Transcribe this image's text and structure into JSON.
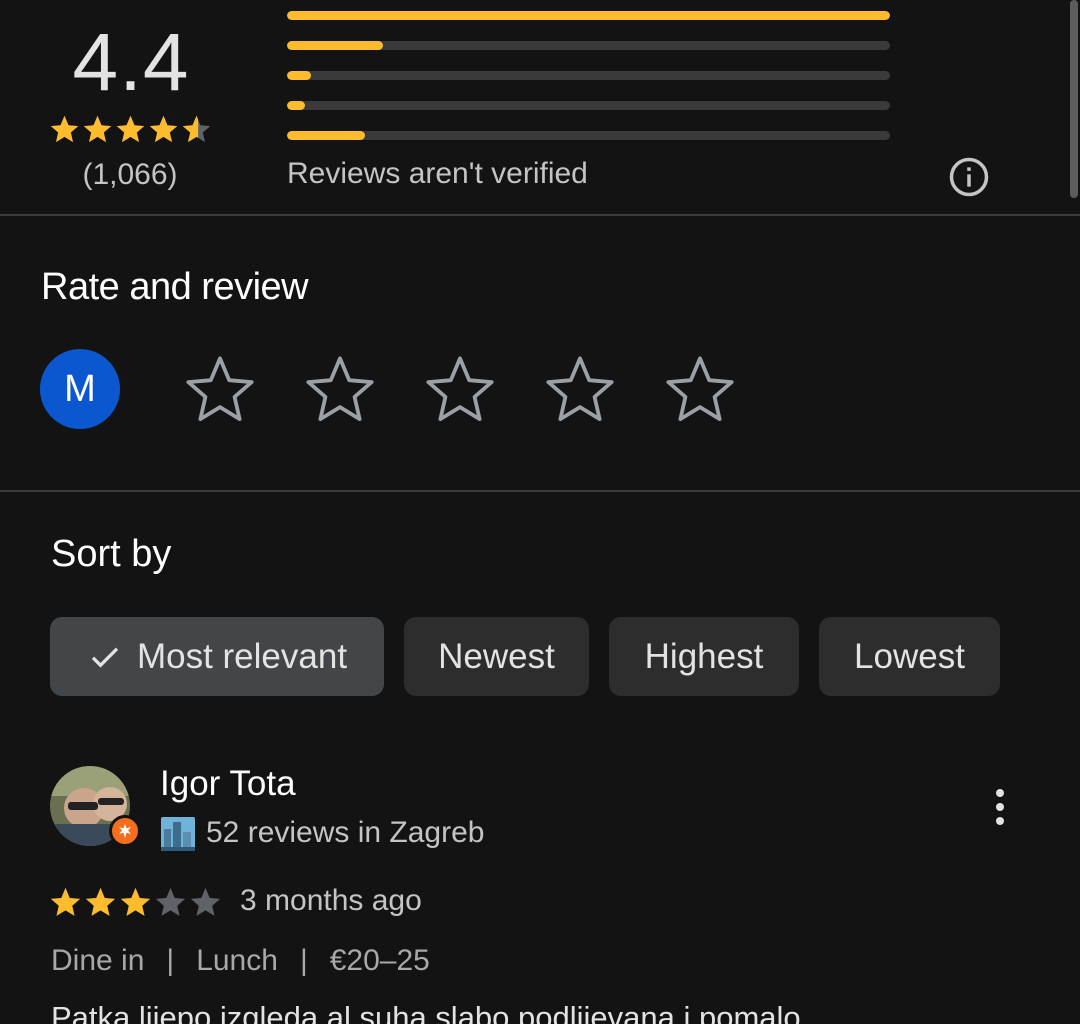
{
  "summary": {
    "rating": "4.4",
    "rating_value": 4.4,
    "review_count": "(1,066)",
    "distribution": [
      {
        "stars": 5,
        "fraction": 1.0
      },
      {
        "stars": 4,
        "fraction": 0.16
      },
      {
        "stars": 3,
        "fraction": 0.04
      },
      {
        "stars": 2,
        "fraction": 0.03
      },
      {
        "stars": 1,
        "fraction": 0.13
      }
    ],
    "verified_note": "Reviews aren't verified",
    "info_icon": "info-icon"
  },
  "rate": {
    "title": "Rate and review",
    "avatar_letter": "M",
    "avatar_color": "#0b57d0",
    "star_count": 5
  },
  "sort": {
    "title": "Sort by",
    "options": [
      {
        "label": "Most relevant",
        "selected": true
      },
      {
        "label": "Newest",
        "selected": false
      },
      {
        "label": "Highest",
        "selected": false
      },
      {
        "label": "Lowest",
        "selected": false
      }
    ]
  },
  "review": {
    "name": "Igor Tota",
    "meta": "52 reviews in Zagreb",
    "stars": 3,
    "date": "3 months ago",
    "tags": [
      "Dine in",
      "Lunch",
      "€20–25"
    ],
    "text": "Patka lijepo izgleda al suha slabo podlijevana i pomalo"
  },
  "colors": {
    "star": "#fdbb2e",
    "star_empty": "#5f6368",
    "background": "#131313",
    "chip": "#2d2d2d",
    "chip_selected": "#424649",
    "local_guide_badge": "#f56e1e"
  }
}
